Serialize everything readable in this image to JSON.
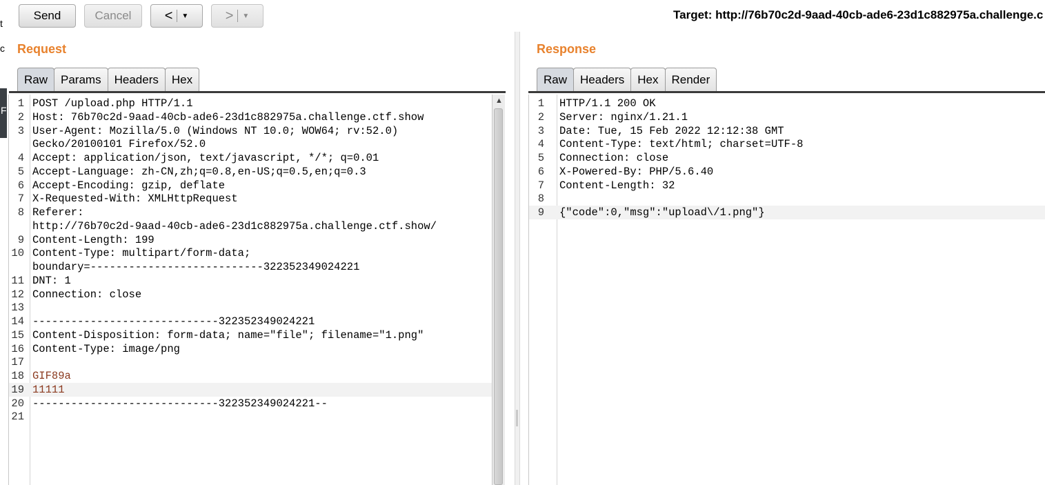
{
  "left_edge": {
    "chars": [
      "t",
      "c"
    ],
    "bar_char": "F"
  },
  "toolbar": {
    "send_label": "Send",
    "cancel_label": "Cancel",
    "back_arrow": "<",
    "forward_arrow": ">",
    "dropdown_glyph": "▼",
    "target_label": "Target: http://76b70c2d-9aad-40cb-ade6-23d1c882975a.challenge.c"
  },
  "request": {
    "title": "Request",
    "tabs": [
      "Raw",
      "Params",
      "Headers",
      "Hex"
    ],
    "active_tab": "Raw",
    "lines": [
      {
        "n": "1",
        "t": "POST /upload.php HTTP/1.1"
      },
      {
        "n": "2",
        "t": "Host: 76b70c2d-9aad-40cb-ade6-23d1c882975a.challenge.ctf.show"
      },
      {
        "n": "3",
        "t": "User-Agent: Mozilla/5.0 (Windows NT 10.0; WOW64; rv:52.0)"
      },
      {
        "n": "",
        "t": "Gecko/20100101 Firefox/52.0"
      },
      {
        "n": "4",
        "t": "Accept: application/json, text/javascript, */*; q=0.01"
      },
      {
        "n": "5",
        "t": "Accept-Language: zh-CN,zh;q=0.8,en-US;q=0.5,en;q=0.3"
      },
      {
        "n": "6",
        "t": "Accept-Encoding: gzip, deflate"
      },
      {
        "n": "7",
        "t": "X-Requested-With: XMLHttpRequest"
      },
      {
        "n": "8",
        "t": "Referer:"
      },
      {
        "n": "",
        "t": "http://76b70c2d-9aad-40cb-ade6-23d1c882975a.challenge.ctf.show/"
      },
      {
        "n": "9",
        "t": "Content-Length: 199"
      },
      {
        "n": "10",
        "t": "Content-Type: multipart/form-data;"
      },
      {
        "n": "",
        "t": "boundary=---------------------------322352349024221"
      },
      {
        "n": "11",
        "t": "DNT: 1"
      },
      {
        "n": "12",
        "t": "Connection: close"
      },
      {
        "n": "13",
        "t": ""
      },
      {
        "n": "14",
        "t": "-----------------------------322352349024221"
      },
      {
        "n": "15",
        "t": "Content-Disposition: form-data; name=\"file\"; filename=\"1.png\""
      },
      {
        "n": "16",
        "t": "Content-Type: image/png"
      },
      {
        "n": "17",
        "t": ""
      },
      {
        "n": "18",
        "t": "GIF89a",
        "body": true
      },
      {
        "n": "19",
        "t": "11111",
        "body": true,
        "hl": true
      },
      {
        "n": "20",
        "t": "-----------------------------322352349024221--"
      },
      {
        "n": "21",
        "t": ""
      }
    ]
  },
  "response": {
    "title": "Response",
    "tabs": [
      "Raw",
      "Headers",
      "Hex",
      "Render"
    ],
    "active_tab": "Raw",
    "lines": [
      {
        "n": "1",
        "t": "HTTP/1.1 200 OK"
      },
      {
        "n": "2",
        "t": "Server: nginx/1.21.1"
      },
      {
        "n": "3",
        "t": "Date: Tue, 15 Feb 2022 12:12:38 GMT"
      },
      {
        "n": "4",
        "t": "Content-Type: text/html; charset=UTF-8"
      },
      {
        "n": "5",
        "t": "Connection: close"
      },
      {
        "n": "6",
        "t": "X-Powered-By: PHP/5.6.40"
      },
      {
        "n": "7",
        "t": "Content-Length: 32"
      },
      {
        "n": "8",
        "t": ""
      },
      {
        "n": "9",
        "t": "{\"code\":0,\"msg\":\"upload\\/1.png\"}",
        "hl": true
      }
    ]
  }
}
